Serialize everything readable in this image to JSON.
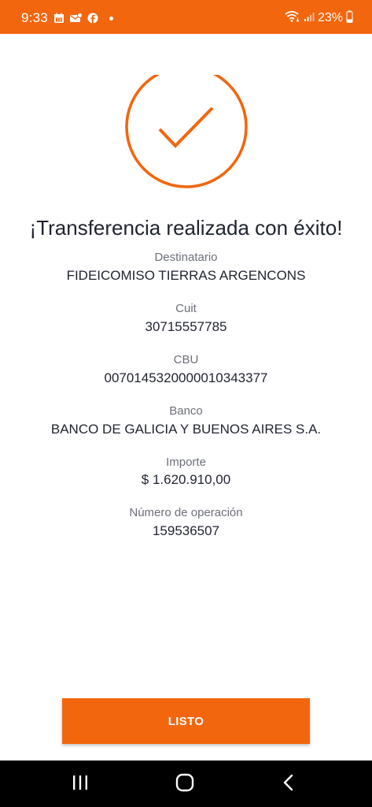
{
  "status_bar": {
    "time": "9:33",
    "battery_text": "23%",
    "background_color": "#f2660e",
    "left_icons": [
      "calendar-icon",
      "mail-icon",
      "facebook-icon",
      "notification-dot-icon"
    ],
    "right_icons": [
      "wifi-icon",
      "signal-icon",
      "battery-icon"
    ]
  },
  "success": {
    "icon": "checkmark-circle-icon",
    "accent_color": "#f2660e",
    "title": "¡Transferencia realizada con éxito!"
  },
  "details": [
    {
      "label": "Destinatario",
      "value": "FIDEICOMISO TIERRAS ARGENCONS"
    },
    {
      "label": "Cuit",
      "value": "30715557785"
    },
    {
      "label": "CBU",
      "value": "0070145320000010343377"
    },
    {
      "label": "Banco",
      "value": "BANCO DE GALICIA Y BUENOS AIRES S.A."
    },
    {
      "label": "Importe",
      "value": "$ 1.620.910,00"
    },
    {
      "label": "Número de operación",
      "value": "159536507"
    }
  ],
  "actions": {
    "done_label": "LISTO"
  },
  "nav_bar": {
    "buttons": [
      "recent-apps-icon",
      "home-icon",
      "back-icon"
    ]
  }
}
